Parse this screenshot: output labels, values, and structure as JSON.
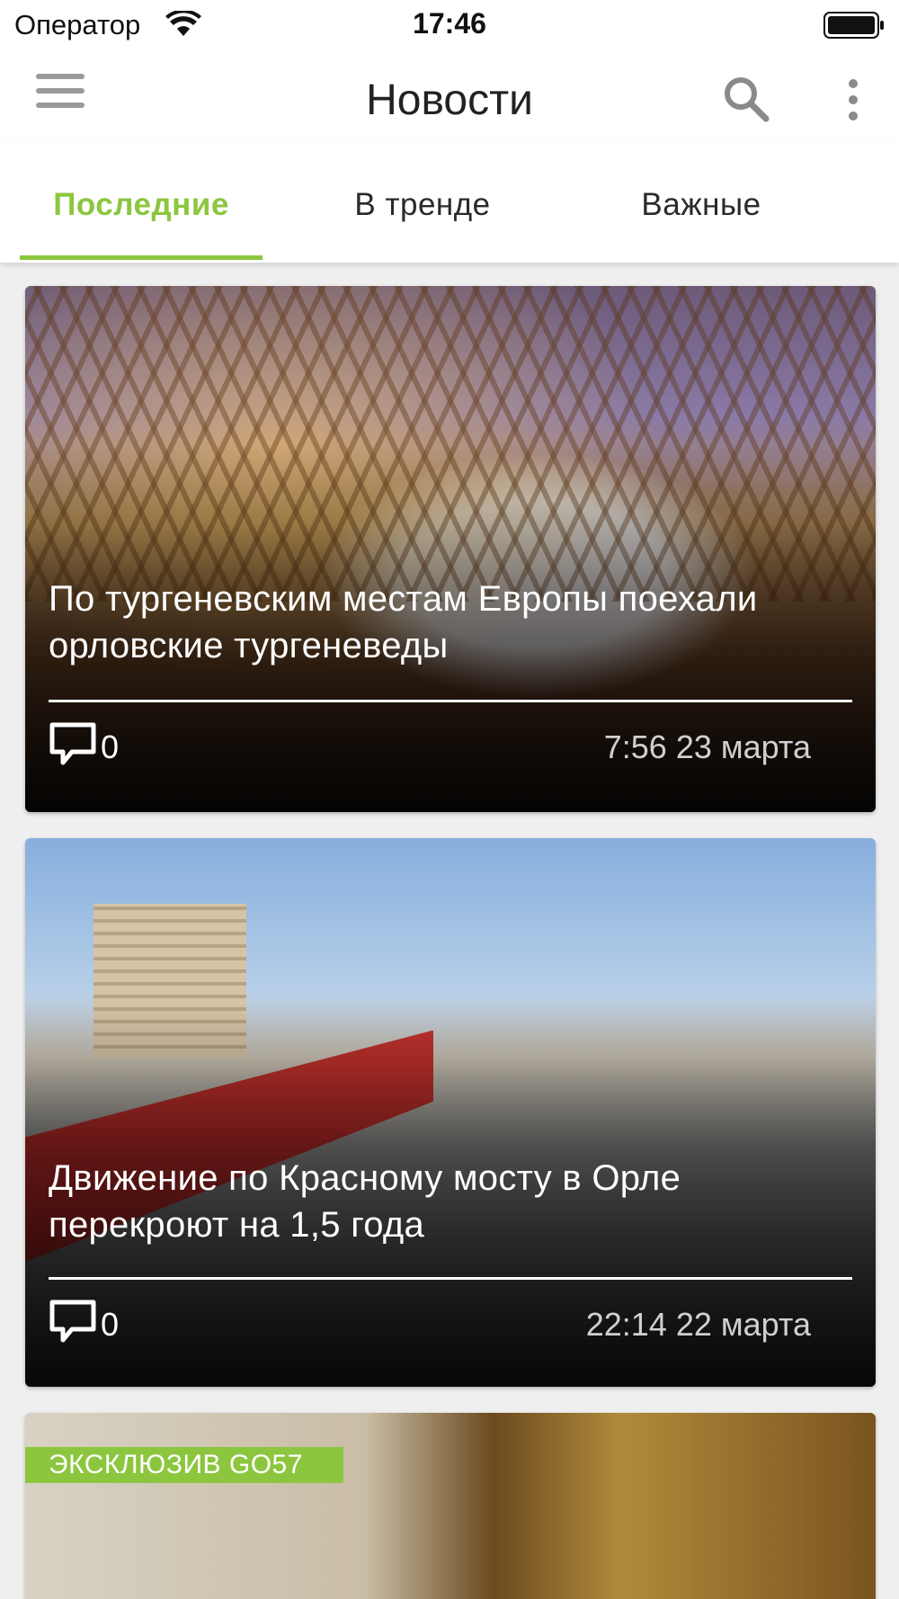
{
  "status_bar": {
    "carrier": "Оператор",
    "time": "17:46"
  },
  "app_bar": {
    "title": "Новости",
    "menu_icon": "hamburger-menu-icon",
    "search_icon": "search-icon",
    "more_icon": "more-vertical-icon"
  },
  "tabs": [
    {
      "label": "Последние",
      "active": true
    },
    {
      "label": "В тренде",
      "active": false
    },
    {
      "label": "Важные",
      "active": false
    }
  ],
  "colors": {
    "accent": "#8cc63f",
    "tab_text": "#2a2a2a",
    "date_text": "#d0d0d0"
  },
  "news": [
    {
      "title": "По тургеневским местам Европы поехали орловские тургеневеды",
      "comments": "0",
      "date": "7:56 23 марта"
    },
    {
      "title": "Движение по Красному мосту в Орле перекроют на 1,5 года",
      "comments": "0",
      "date": "22:14 22 марта"
    },
    {
      "badge": "ЭКСКЛЮЗИВ GO57"
    }
  ]
}
